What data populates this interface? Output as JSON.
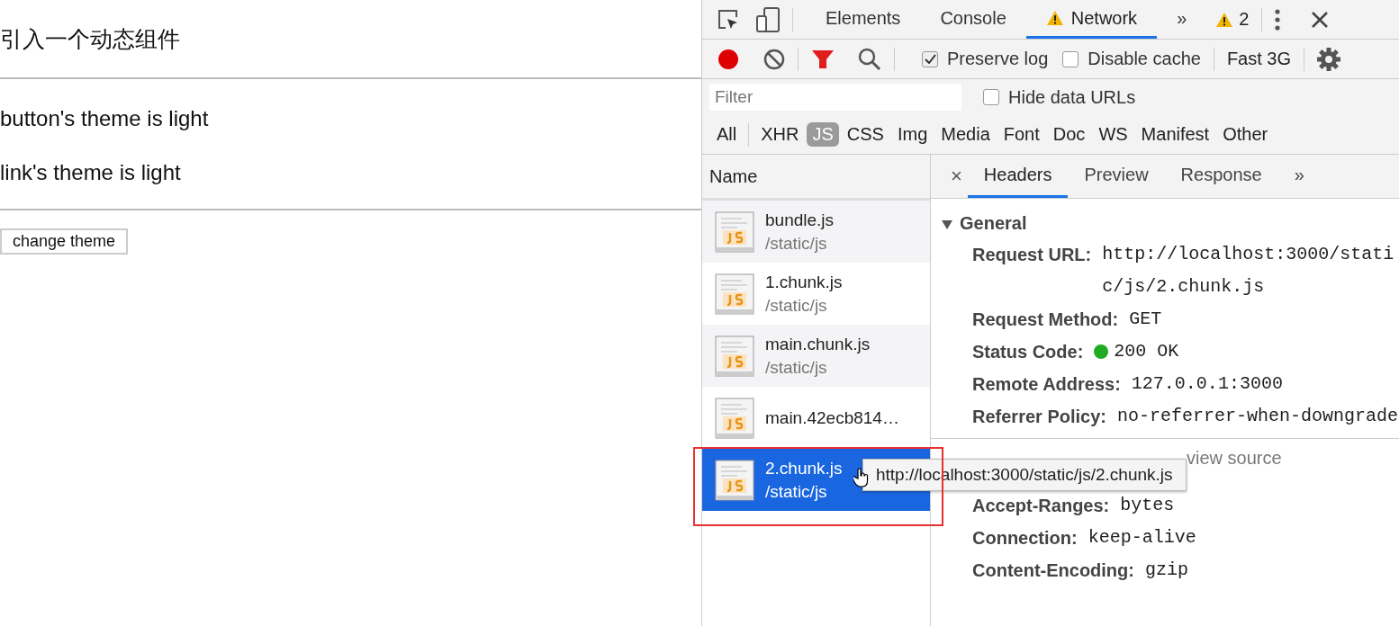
{
  "page": {
    "heading": "引入一个动态组件",
    "lines": [
      "button's theme is light",
      "link's theme is light"
    ],
    "button": "change theme"
  },
  "devtools": {
    "tabs": [
      {
        "label": "Elements",
        "selected": false,
        "warning": false
      },
      {
        "label": "Console",
        "selected": false,
        "warning": false
      },
      {
        "label": "Network",
        "selected": true,
        "warning": true
      }
    ],
    "more": "»",
    "warning_count": "2",
    "toolbar": {
      "recording": true,
      "filter_on": true,
      "preserve_log": {
        "label": "Preserve log",
        "checked": true
      },
      "disable_cache": {
        "label": "Disable cache",
        "checked": false
      },
      "throttle": "Fast 3G"
    },
    "filter": {
      "placeholder": "Filter",
      "hide_data_urls": {
        "label": "Hide data URLs",
        "checked": false
      }
    },
    "types": [
      {
        "label": "All",
        "selected": false
      },
      {
        "label": "XHR",
        "selected": false
      },
      {
        "label": "JS",
        "selected": true
      },
      {
        "label": "CSS",
        "selected": false
      },
      {
        "label": "Img",
        "selected": false
      },
      {
        "label": "Media",
        "selected": false
      },
      {
        "label": "Font",
        "selected": false
      },
      {
        "label": "Doc",
        "selected": false
      },
      {
        "label": "WS",
        "selected": false
      },
      {
        "label": "Manifest",
        "selected": false
      },
      {
        "label": "Other",
        "selected": false
      }
    ],
    "name_header": "Name",
    "requests": [
      {
        "name": "bundle.js",
        "path": "/static/js",
        "selected": false
      },
      {
        "name": "1.chunk.js",
        "path": "/static/js",
        "selected": false
      },
      {
        "name": "main.chunk.js",
        "path": "/static/js",
        "selected": false
      },
      {
        "name": "main.42ecb814…",
        "selected": false
      },
      {
        "name": "2.chunk.js",
        "path": "/static/js",
        "selected": true
      }
    ],
    "detail_close": "×",
    "detail_tabs": [
      {
        "label": "Headers",
        "selected": true
      },
      {
        "label": "Preview",
        "selected": false
      },
      {
        "label": "Response",
        "selected": false
      }
    ],
    "detail_more": "»",
    "general": {
      "title": "General",
      "expanded": true,
      "rows": [
        {
          "key": "Request URL:",
          "value": "http://localhost:3000/static/js/2.chunk.js"
        },
        {
          "key": "Request Method:",
          "value": "GET"
        },
        {
          "key": "Status Code:",
          "value": "200 OK",
          "color": "#22aa22"
        },
        {
          "key": "Remote Address:",
          "value": "127.0.0.1:3000"
        },
        {
          "key": "Referrer Policy:",
          "value": "no-referrer-when-downgrade"
        }
      ]
    },
    "response": {
      "link": "view source",
      "rows": [
        {
          "key": "Accept-Ranges:",
          "value": "bytes"
        },
        {
          "key": "Connection:",
          "value": "keep-alive"
        },
        {
          "key": "Content-Encoding:",
          "value": "gzip"
        }
      ]
    },
    "tooltip": "http://localhost:3000/static/js/2.chunk.js"
  }
}
